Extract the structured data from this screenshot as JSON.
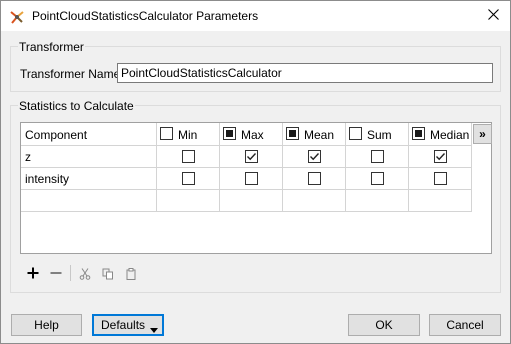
{
  "window": {
    "title": "PointCloudStatisticsCalculator Parameters"
  },
  "transformer_group": {
    "title": "Transformer",
    "name_label": "Transformer Name:",
    "name_value": "PointCloudStatisticsCalculator"
  },
  "stats_group": {
    "title": "Statistics to Calculate",
    "columns": [
      {
        "label": "Component"
      },
      {
        "label": "Min",
        "header_state": "unchecked"
      },
      {
        "label": "Max",
        "header_state": "partial"
      },
      {
        "label": "Mean",
        "header_state": "partial"
      },
      {
        "label": "Sum",
        "header_state": "unchecked"
      },
      {
        "label": "Median",
        "header_state": "partial"
      }
    ],
    "more_columns_button": "»",
    "rows": [
      {
        "component": "z",
        "min": false,
        "max": true,
        "mean": true,
        "sum": false,
        "median": true
      },
      {
        "component": "intensity",
        "min": false,
        "max": false,
        "mean": false,
        "sum": false,
        "median": false
      }
    ]
  },
  "toolbar": {
    "add_icon": "plus-icon",
    "remove_icon": "minus-icon",
    "cut_icon": "scissors-icon",
    "copy_icon": "copy-icon",
    "paste_icon": "paste-icon"
  },
  "buttons": {
    "help": "Help",
    "defaults": "Defaults",
    "ok": "OK",
    "cancel": "Cancel"
  },
  "colors": {
    "accent": "#0078d7",
    "title_bg": "#ffffff",
    "dialog_bg": "#f0f0f0"
  }
}
